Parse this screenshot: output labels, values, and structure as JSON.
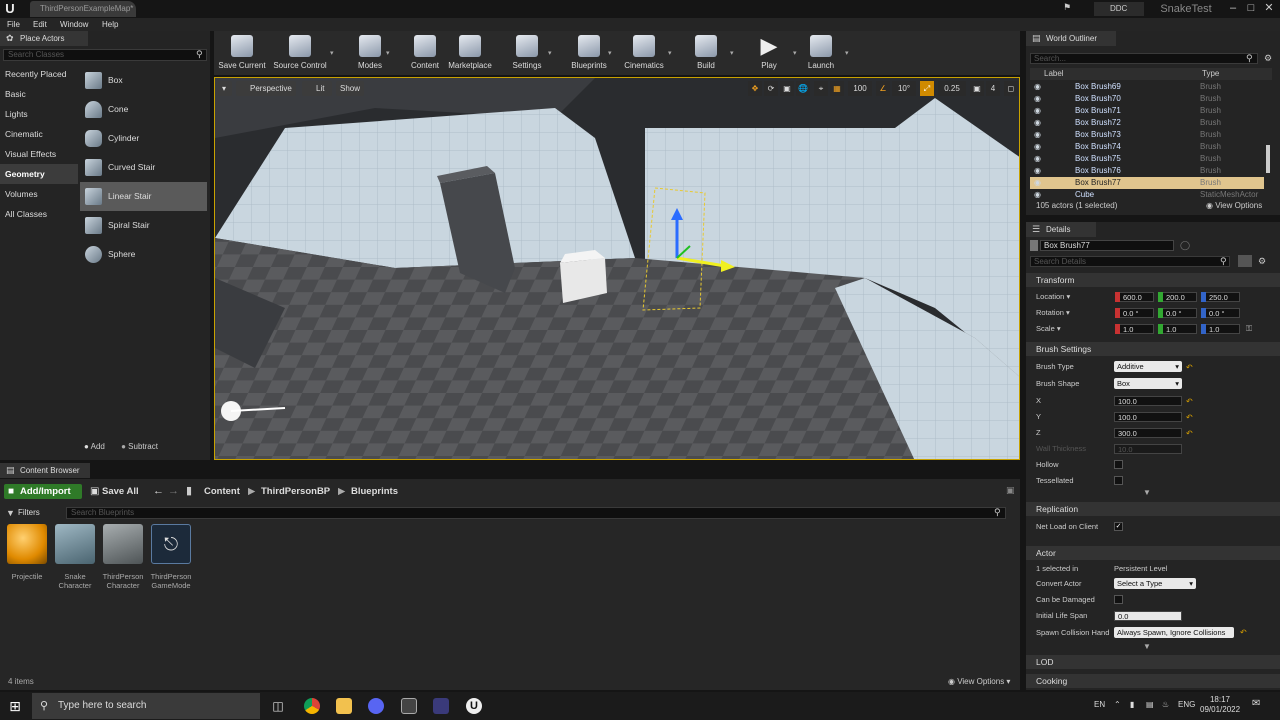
{
  "window": {
    "tab_title": "ThirdPersonExampleMap*",
    "ddc_label": "DDC",
    "project_title": "SnakeTest"
  },
  "menu": [
    "File",
    "Edit",
    "Window",
    "Help"
  ],
  "place_actors": {
    "tab": "Place Actors",
    "search_placeholder": "Search Classes",
    "categories": [
      "Recently Placed",
      "Basic",
      "Lights",
      "Cinematic",
      "Visual Effects",
      "Geometry",
      "Volumes",
      "All Classes"
    ],
    "selected_category": "Geometry",
    "shapes": [
      "Box",
      "Cone",
      "Cylinder",
      "Curved Stair",
      "Linear Stair",
      "Spiral Stair",
      "Sphere"
    ],
    "selected_shape": "Linear Stair",
    "add_label": "Add",
    "subtract_label": "Subtract"
  },
  "toolbar": [
    "Save Current",
    "Source Control",
    "Modes",
    "Content",
    "Marketplace",
    "Settings",
    "Blueprints",
    "Cinematics",
    "Build",
    "Play",
    "Launch"
  ],
  "viewport": {
    "perspective": "Perspective",
    "lit": "Lit",
    "show": "Show",
    "grid_snap": "100",
    "rot_snap": "10°",
    "scale_snap": "0.25",
    "cam_speed": "4"
  },
  "content_browser": {
    "tab": "Content Browser",
    "add_import": "Add/Import",
    "save_all": "Save All",
    "breadcrumb": [
      "Content",
      "ThirdPersonBP",
      "Blueprints"
    ],
    "filters": "Filters",
    "search_placeholder": "Search Blueprints",
    "assets": [
      {
        "label": "Projectile",
        "color": "#f0a020"
      },
      {
        "label": "Snake Character",
        "color": "#6a8796"
      },
      {
        "label": "ThirdPerson Character",
        "color": "#7a8080"
      },
      {
        "label": "ThirdPerson GameMode",
        "color": "#1c2a3a"
      }
    ],
    "item_count": "4 items",
    "view_options": "View Options"
  },
  "world_outliner": {
    "tab": "World Outliner",
    "search_placeholder": "Search...",
    "col_label": "Label",
    "col_type": "Type",
    "rows": [
      {
        "label": "Box Brush69",
        "type": "Brush"
      },
      {
        "label": "Box Brush70",
        "type": "Brush"
      },
      {
        "label": "Box Brush71",
        "type": "Brush"
      },
      {
        "label": "Box Brush72",
        "type": "Brush"
      },
      {
        "label": "Box Brush73",
        "type": "Brush"
      },
      {
        "label": "Box Brush74",
        "type": "Brush"
      },
      {
        "label": "Box Brush75",
        "type": "Brush"
      },
      {
        "label": "Box Brush76",
        "type": "Brush"
      },
      {
        "label": "Box Brush77",
        "type": "Brush"
      },
      {
        "label": "Cube",
        "type": "StaticMeshActor"
      }
    ],
    "selected_row": "Box Brush77",
    "actor_count": "105 actors (1 selected)",
    "view_options": "View Options"
  },
  "details": {
    "tab": "Details",
    "object_name": "Box Brush77",
    "search_placeholder": "Search Details",
    "transform": {
      "header": "Transform",
      "location_label": "Location",
      "location": [
        "600.0",
        "200.0",
        "250.0"
      ],
      "rotation_label": "Rotation",
      "rotation": [
        "0.0 °",
        "0.0 °",
        "0.0 °"
      ],
      "scale_label": "Scale",
      "scale": [
        "1.0",
        "1.0",
        "1.0"
      ]
    },
    "brush_settings": {
      "header": "Brush Settings",
      "brush_type_label": "Brush Type",
      "brush_type": "Additive",
      "brush_shape_label": "Brush Shape",
      "brush_shape": "Box",
      "x_label": "X",
      "x": "100.0",
      "y_label": "Y",
      "y": "100.0",
      "z_label": "Z",
      "z": "300.0",
      "wall_label": "Wall Thickness",
      "wall": "10.0",
      "hollow_label": "Hollow",
      "tessellated_label": "Tessellated"
    },
    "replication": {
      "header": "Replication",
      "net_load_label": "Net Load on Client"
    },
    "actor": {
      "header": "Actor",
      "selected_in_label": "1 selected in",
      "selected_in_value": "Persistent Level",
      "convert_label": "Convert Actor",
      "convert_value": "Select a Type",
      "damaged_label": "Can be Damaged",
      "lifespan_label": "Initial Life Span",
      "lifespan_value": "0.0",
      "spawn_label": "Spawn Collision Hand",
      "spawn_value": "Always Spawn, Ignore Collisions"
    },
    "lod_header": "LOD",
    "cooking_header": "Cooking"
  },
  "taskbar": {
    "search_placeholder": "Type here to search",
    "lang_left": "EN",
    "lang_right": "ENG",
    "time": "18:17",
    "date": "09/01/2022"
  },
  "colors": {
    "accent_select": "#e0c58e",
    "add_import_green": "#2f7a28",
    "viewport_border": "#c8a200"
  }
}
